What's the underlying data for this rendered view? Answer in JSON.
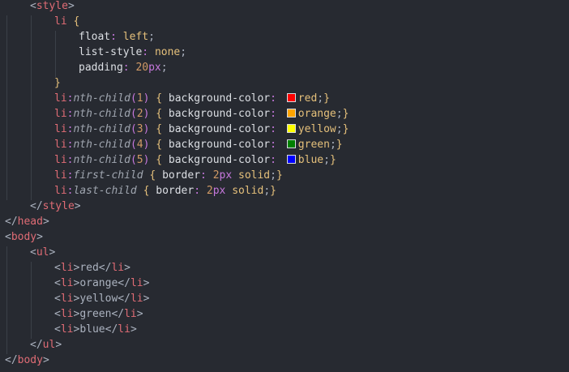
{
  "editor": {
    "language": "html",
    "colors": {
      "background": "#272a31",
      "tag": "#e06c75",
      "brace": "#e5c07b",
      "paren": "#c678dd",
      "property": "#dcdfe4",
      "value": "#e5c07b",
      "number": "#d19a66",
      "unit": "#c678dd",
      "pseudo": "#a0a6b0"
    },
    "lines": [
      [
        {
          "t": "<",
          "c": "t-punct"
        },
        {
          "t": "style",
          "c": "t-tag"
        },
        {
          "t": ">",
          "c": "t-punct"
        }
      ],
      [
        {
          "t": "li",
          "c": "t-tag"
        },
        {
          "t": " ",
          "c": "t-punct"
        },
        {
          "t": "{",
          "c": "t-brace"
        }
      ],
      [
        {
          "t": "float",
          "c": "t-prop"
        },
        {
          "t": ": ",
          "c": "t-colon"
        },
        {
          "t": "left",
          "c": "t-val"
        },
        {
          "t": ";",
          "c": "t-punct"
        }
      ],
      [
        {
          "t": "list-style",
          "c": "t-prop"
        },
        {
          "t": ": ",
          "c": "t-colon"
        },
        {
          "t": "none",
          "c": "t-val"
        },
        {
          "t": ";",
          "c": "t-punct"
        }
      ],
      [
        {
          "t": "padding",
          "c": "t-prop"
        },
        {
          "t": ": ",
          "c": "t-colon"
        },
        {
          "t": "20",
          "c": "t-num"
        },
        {
          "t": "px",
          "c": "t-unit"
        },
        {
          "t": ";",
          "c": "t-punct"
        }
      ],
      [
        {
          "t": "}",
          "c": "t-brace"
        }
      ],
      [
        {
          "t": "li",
          "c": "t-tag"
        },
        {
          "t": ":",
          "c": "t-colon"
        },
        {
          "t": "nth-child",
          "c": "t-pseudo"
        },
        {
          "t": "(",
          "c": "t-paren"
        },
        {
          "t": "1",
          "c": "t-num"
        },
        {
          "t": ")",
          "c": "t-paren"
        },
        {
          "t": " ",
          "c": "t-punct"
        },
        {
          "t": "{",
          "c": "t-brace"
        },
        {
          "t": " ",
          "c": "t-punct"
        },
        {
          "t": "background-color",
          "c": "t-prop"
        },
        {
          "t": ": ",
          "c": "t-colon"
        },
        {
          "swatch": "#ff0000"
        },
        {
          "t": "red",
          "c": "t-val"
        },
        {
          "t": ";",
          "c": "t-punct"
        },
        {
          "t": "}",
          "c": "t-brace"
        }
      ],
      [
        {
          "t": "li",
          "c": "t-tag"
        },
        {
          "t": ":",
          "c": "t-colon"
        },
        {
          "t": "nth-child",
          "c": "t-pseudo"
        },
        {
          "t": "(",
          "c": "t-paren"
        },
        {
          "t": "2",
          "c": "t-num"
        },
        {
          "t": ")",
          "c": "t-paren"
        },
        {
          "t": " ",
          "c": "t-punct"
        },
        {
          "t": "{",
          "c": "t-brace"
        },
        {
          "t": " ",
          "c": "t-punct"
        },
        {
          "t": "background-color",
          "c": "t-prop"
        },
        {
          "t": ": ",
          "c": "t-colon"
        },
        {
          "swatch": "#ffa500"
        },
        {
          "t": "orange",
          "c": "t-val"
        },
        {
          "t": ";",
          "c": "t-punct"
        },
        {
          "t": "}",
          "c": "t-brace"
        }
      ],
      [
        {
          "t": "li",
          "c": "t-tag"
        },
        {
          "t": ":",
          "c": "t-colon"
        },
        {
          "t": "nth-child",
          "c": "t-pseudo"
        },
        {
          "t": "(",
          "c": "t-paren"
        },
        {
          "t": "3",
          "c": "t-num"
        },
        {
          "t": ")",
          "c": "t-paren"
        },
        {
          "t": " ",
          "c": "t-punct"
        },
        {
          "t": "{",
          "c": "t-brace"
        },
        {
          "t": " ",
          "c": "t-punct"
        },
        {
          "t": "background-color",
          "c": "t-prop"
        },
        {
          "t": ": ",
          "c": "t-colon"
        },
        {
          "swatch": "#ffff00"
        },
        {
          "t": "yellow",
          "c": "t-val"
        },
        {
          "t": ";",
          "c": "t-punct"
        },
        {
          "t": "}",
          "c": "t-brace"
        }
      ],
      [
        {
          "t": "li",
          "c": "t-tag"
        },
        {
          "t": ":",
          "c": "t-colon"
        },
        {
          "t": "nth-child",
          "c": "t-pseudo"
        },
        {
          "t": "(",
          "c": "t-paren"
        },
        {
          "t": "4",
          "c": "t-num"
        },
        {
          "t": ")",
          "c": "t-paren"
        },
        {
          "t": " ",
          "c": "t-punct"
        },
        {
          "t": "{",
          "c": "t-brace"
        },
        {
          "t": " ",
          "c": "t-punct"
        },
        {
          "t": "background-color",
          "c": "t-prop"
        },
        {
          "t": ": ",
          "c": "t-colon"
        },
        {
          "swatch": "#008000"
        },
        {
          "t": "green",
          "c": "t-val"
        },
        {
          "t": ";",
          "c": "t-punct"
        },
        {
          "t": "}",
          "c": "t-brace"
        }
      ],
      [
        {
          "t": "li",
          "c": "t-tag"
        },
        {
          "t": ":",
          "c": "t-colon"
        },
        {
          "t": "nth-child",
          "c": "t-pseudo"
        },
        {
          "t": "(",
          "c": "t-paren"
        },
        {
          "t": "5",
          "c": "t-num"
        },
        {
          "t": ")",
          "c": "t-paren"
        },
        {
          "t": " ",
          "c": "t-punct"
        },
        {
          "t": "{",
          "c": "t-brace"
        },
        {
          "t": " ",
          "c": "t-punct"
        },
        {
          "t": "background-color",
          "c": "t-prop"
        },
        {
          "t": ": ",
          "c": "t-colon"
        },
        {
          "swatch": "#0000ff"
        },
        {
          "t": "blue",
          "c": "t-val"
        },
        {
          "t": ";",
          "c": "t-punct"
        },
        {
          "t": "}",
          "c": "t-brace"
        }
      ],
      [
        {
          "t": "li",
          "c": "t-tag"
        },
        {
          "t": ":",
          "c": "t-colon"
        },
        {
          "t": "first-child",
          "c": "t-pseudo"
        },
        {
          "t": " ",
          "c": "t-punct"
        },
        {
          "t": "{",
          "c": "t-brace"
        },
        {
          "t": " ",
          "c": "t-punct"
        },
        {
          "t": "border",
          "c": "t-prop"
        },
        {
          "t": ": ",
          "c": "t-colon"
        },
        {
          "t": "2",
          "c": "t-num"
        },
        {
          "t": "px",
          "c": "t-unit"
        },
        {
          "t": " ",
          "c": "t-punct"
        },
        {
          "t": "solid",
          "c": "t-val"
        },
        {
          "t": ";",
          "c": "t-punct"
        },
        {
          "t": "}",
          "c": "t-brace"
        }
      ],
      [
        {
          "t": "li",
          "c": "t-tag"
        },
        {
          "t": ":",
          "c": "t-colon"
        },
        {
          "t": "last-child",
          "c": "t-pseudo"
        },
        {
          "t": " ",
          "c": "t-punct"
        },
        {
          "t": "{",
          "c": "t-brace"
        },
        {
          "t": " ",
          "c": "t-punct"
        },
        {
          "t": "border",
          "c": "t-prop"
        },
        {
          "t": ": ",
          "c": "t-colon"
        },
        {
          "t": "2",
          "c": "t-num"
        },
        {
          "t": "px",
          "c": "t-unit"
        },
        {
          "t": " ",
          "c": "t-punct"
        },
        {
          "t": "solid",
          "c": "t-val"
        },
        {
          "t": ";",
          "c": "t-punct"
        },
        {
          "t": "}",
          "c": "t-brace"
        }
      ],
      [
        {
          "t": "</",
          "c": "t-punct"
        },
        {
          "t": "style",
          "c": "t-tag"
        },
        {
          "t": ">",
          "c": "t-punct"
        }
      ],
      [
        {
          "t": "</",
          "c": "t-punct"
        },
        {
          "t": "head",
          "c": "t-tag"
        },
        {
          "t": ">",
          "c": "t-punct"
        }
      ],
      [
        {
          "t": "<",
          "c": "t-punct"
        },
        {
          "t": "body",
          "c": "t-tag"
        },
        {
          "t": ">",
          "c": "t-punct"
        }
      ],
      [
        {
          "t": "<",
          "c": "t-punct"
        },
        {
          "t": "ul",
          "c": "t-tag"
        },
        {
          "t": ">",
          "c": "t-punct"
        }
      ],
      [
        {
          "t": "<",
          "c": "t-punct"
        },
        {
          "t": "li",
          "c": "t-tag"
        },
        {
          "t": ">",
          "c": "t-punct"
        },
        {
          "t": "red",
          "c": "t-punct"
        },
        {
          "t": "</",
          "c": "t-punct"
        },
        {
          "t": "li",
          "c": "t-tag"
        },
        {
          "t": ">",
          "c": "t-punct"
        }
      ],
      [
        {
          "t": "<",
          "c": "t-punct"
        },
        {
          "t": "li",
          "c": "t-tag"
        },
        {
          "t": ">",
          "c": "t-punct"
        },
        {
          "t": "orange",
          "c": "t-punct"
        },
        {
          "t": "</",
          "c": "t-punct"
        },
        {
          "t": "li",
          "c": "t-tag"
        },
        {
          "t": ">",
          "c": "t-punct"
        }
      ],
      [
        {
          "t": "<",
          "c": "t-punct"
        },
        {
          "t": "li",
          "c": "t-tag"
        },
        {
          "t": ">",
          "c": "t-punct"
        },
        {
          "t": "yellow",
          "c": "t-punct"
        },
        {
          "t": "</",
          "c": "t-punct"
        },
        {
          "t": "li",
          "c": "t-tag"
        },
        {
          "t": ">",
          "c": "t-punct"
        }
      ],
      [
        {
          "t": "<",
          "c": "t-punct"
        },
        {
          "t": "li",
          "c": "t-tag"
        },
        {
          "t": ">",
          "c": "t-punct"
        },
        {
          "t": "green",
          "c": "t-punct"
        },
        {
          "t": "</",
          "c": "t-punct"
        },
        {
          "t": "li",
          "c": "t-tag"
        },
        {
          "t": ">",
          "c": "t-punct"
        }
      ],
      [
        {
          "t": "<",
          "c": "t-punct"
        },
        {
          "t": "li",
          "c": "t-tag"
        },
        {
          "t": ">",
          "c": "t-punct"
        },
        {
          "t": "blue",
          "c": "t-punct"
        },
        {
          "t": "</",
          "c": "t-punct"
        },
        {
          "t": "li",
          "c": "t-tag"
        },
        {
          "t": ">",
          "c": "t-punct"
        }
      ],
      [
        {
          "t": "</",
          "c": "t-punct"
        },
        {
          "t": "ul",
          "c": "t-tag"
        },
        {
          "t": ">",
          "c": "t-punct"
        }
      ],
      [
        {
          "t": "</",
          "c": "t-punct"
        },
        {
          "t": "body",
          "c": "t-tag"
        },
        {
          "t": ">",
          "c": "t-punct"
        }
      ]
    ]
  }
}
